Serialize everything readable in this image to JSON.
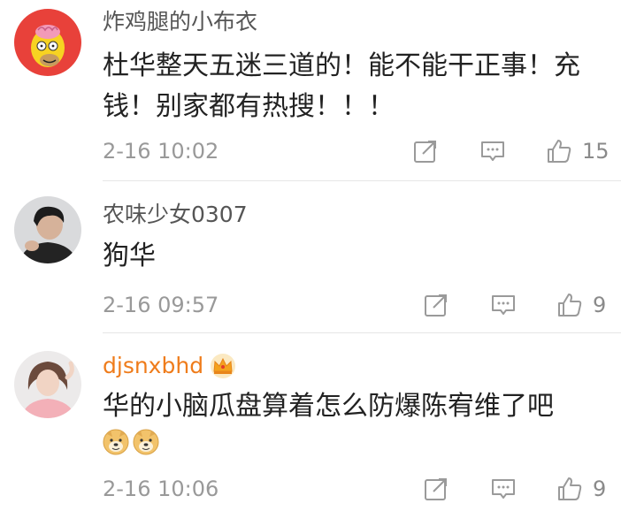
{
  "comments": [
    {
      "username": "炸鸡腿的小布衣",
      "text": "杜华整天五迷三道的！能不能干正事！充钱！别家都有热搜！！！",
      "timestamp": "2-16 10:02",
      "likes": "15",
      "avatar": "cartoon-character-avatar"
    },
    {
      "username": "农味少女0307",
      "text": "狗华",
      "timestamp": "2-16 09:57",
      "likes": "9",
      "avatar": "person-photo-avatar"
    },
    {
      "username": "djsnxbhd",
      "text": "华的小脑瓜盘算着怎么防爆陈宥维了吧",
      "timestamp": "2-16 10:06",
      "likes": "9",
      "avatar": "person-photo-avatar",
      "badge": "crown-icon",
      "emojis": [
        "doge-emoji",
        "doge-emoji"
      ]
    }
  ],
  "colors": {
    "username_normal": "#555555",
    "username_vip": "#ef7c1b",
    "text": "#222222",
    "meta": "#999999",
    "divider": "#e6e6e6"
  },
  "icons": {
    "repost": "repost-icon",
    "reply": "comment-icon",
    "like": "thumbs-up-icon"
  }
}
